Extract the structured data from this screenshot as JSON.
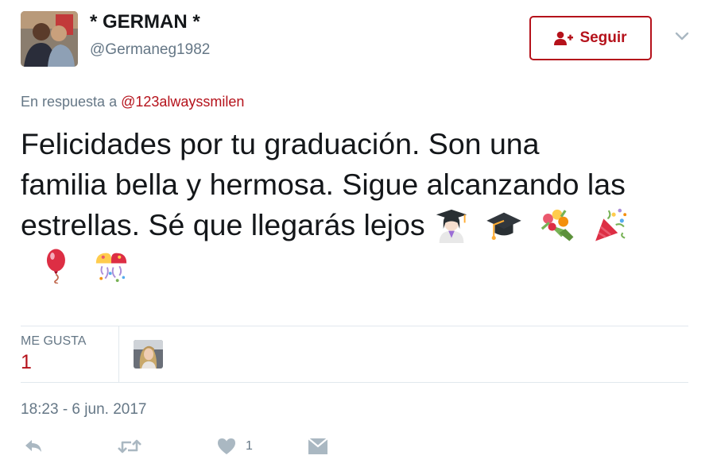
{
  "author": {
    "name": "* GERMAN *",
    "handle": "@Germaneg1982"
  },
  "follow_button": {
    "label": "Seguir"
  },
  "reply_context": {
    "prefix": "En respuesta a",
    "mention": "@123alwayssmilen"
  },
  "tweet": {
    "line1": "Felicidades por tu graduación. Son una",
    "line2": "familia bella y hermosa. Sigue alcanzando las",
    "line3": "estrellas. Sé que llegarás lejos",
    "emojis": [
      "woman-graduate-emoji",
      "graduation-cap-emoji",
      "bouquet-emoji",
      "party-popper-emoji",
      "balloon-emoji",
      "confetti-ball-emoji"
    ]
  },
  "stats": {
    "likes_label": "ME GUSTA",
    "likes_count": "1"
  },
  "timestamp": "18:23 - 6 jun. 2017",
  "actions": {
    "like_count": "1"
  },
  "colors": {
    "accent": "#b5121b",
    "secondary_text": "#657786",
    "primary_text": "#14171a",
    "divider": "#e1e8ed",
    "icon": "#aab8c2"
  }
}
